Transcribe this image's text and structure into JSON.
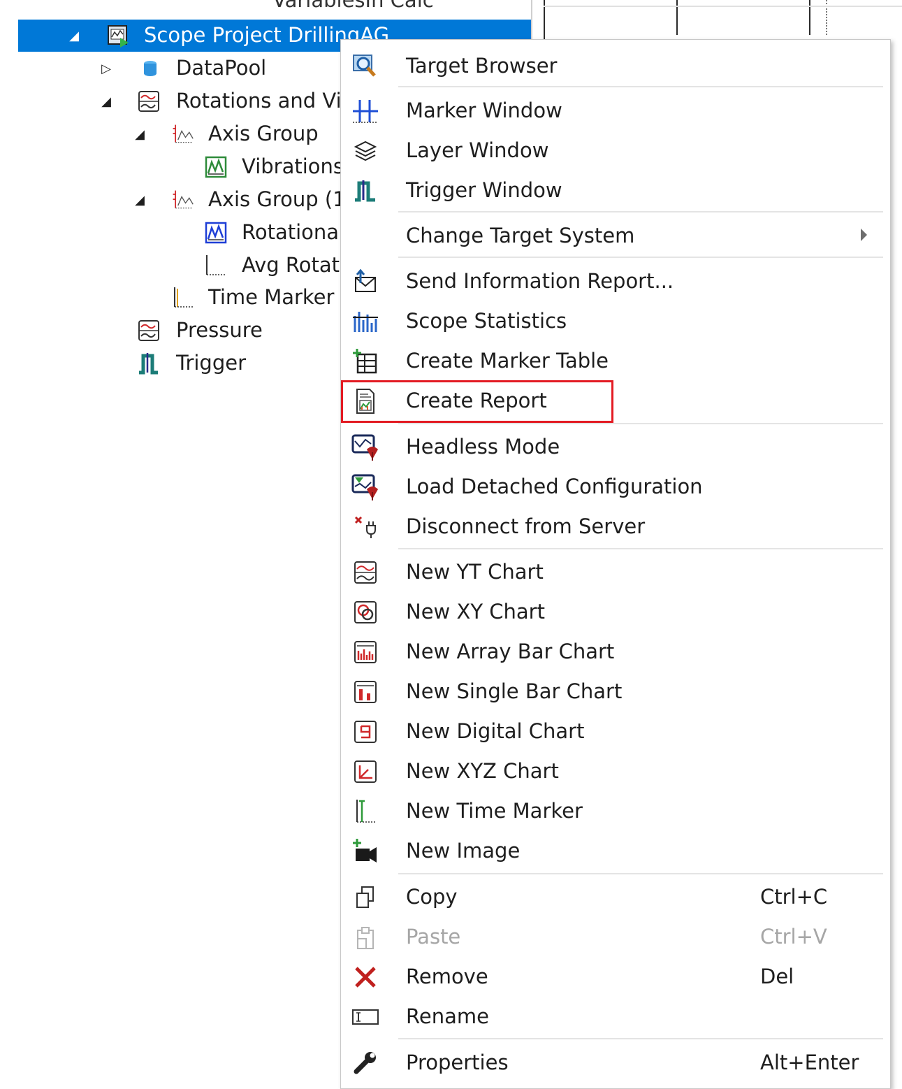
{
  "tree": {
    "partial_top_label": "VariablesIn Calc",
    "items": [
      {
        "label": "Scope Project DrillingAG",
        "selected": true
      },
      {
        "label": "DataPool"
      },
      {
        "label": "Rotations and Vib"
      },
      {
        "label": "Axis Group"
      },
      {
        "label": "Vibrations"
      },
      {
        "label": "Axis Group (1"
      },
      {
        "label": "Rotational"
      },
      {
        "label": "Avg Rotat"
      },
      {
        "label": "Time Marker"
      },
      {
        "label": "Pressure"
      },
      {
        "label": "Trigger"
      }
    ]
  },
  "menu": {
    "items": [
      {
        "label": "Target Browser",
        "icon": "target-browser-icon"
      },
      {
        "label": "Marker Window",
        "icon": "marker-window-icon"
      },
      {
        "label": "Layer Window",
        "icon": "layer-window-icon"
      },
      {
        "label": "Trigger Window",
        "icon": "trigger-window-icon"
      },
      {
        "label": "Change Target System",
        "submenu": true
      },
      {
        "label": "Send Information Report...",
        "icon": "send-report-icon"
      },
      {
        "label": "Scope Statistics",
        "icon": "statistics-icon"
      },
      {
        "label": "Create Marker Table",
        "icon": "marker-table-icon"
      },
      {
        "label": "Create Report",
        "icon": "report-icon",
        "highlighted": true
      },
      {
        "label": "Headless Mode",
        "icon": "headless-mode-icon"
      },
      {
        "label": "Load Detached Configuration",
        "icon": "load-config-icon"
      },
      {
        "label": "Disconnect from Server",
        "icon": "disconnect-icon"
      },
      {
        "label": "New YT Chart",
        "icon": "yt-chart-icon"
      },
      {
        "label": "New XY Chart",
        "icon": "xy-chart-icon"
      },
      {
        "label": "New Array Bar Chart",
        "icon": "array-bar-chart-icon"
      },
      {
        "label": "New Single Bar Chart",
        "icon": "single-bar-chart-icon"
      },
      {
        "label": "New Digital Chart",
        "icon": "digital-chart-icon"
      },
      {
        "label": "New XYZ Chart",
        "icon": "xyz-chart-icon"
      },
      {
        "label": "New Time Marker",
        "icon": "time-marker-icon"
      },
      {
        "label": "New Image",
        "icon": "new-image-icon"
      },
      {
        "label": "Copy",
        "shortcut": "Ctrl+C",
        "icon": "copy-icon"
      },
      {
        "label": "Paste",
        "shortcut": "Ctrl+V",
        "icon": "paste-icon",
        "disabled": true
      },
      {
        "label": "Remove",
        "shortcut": "Del",
        "icon": "remove-icon"
      },
      {
        "label": "Rename",
        "icon": "rename-icon"
      },
      {
        "label": "Properties",
        "shortcut": "Alt+Enter",
        "icon": "properties-icon"
      }
    ]
  },
  "colors": {
    "selection": "#0078d7",
    "highlight_box": "#e31b23"
  }
}
